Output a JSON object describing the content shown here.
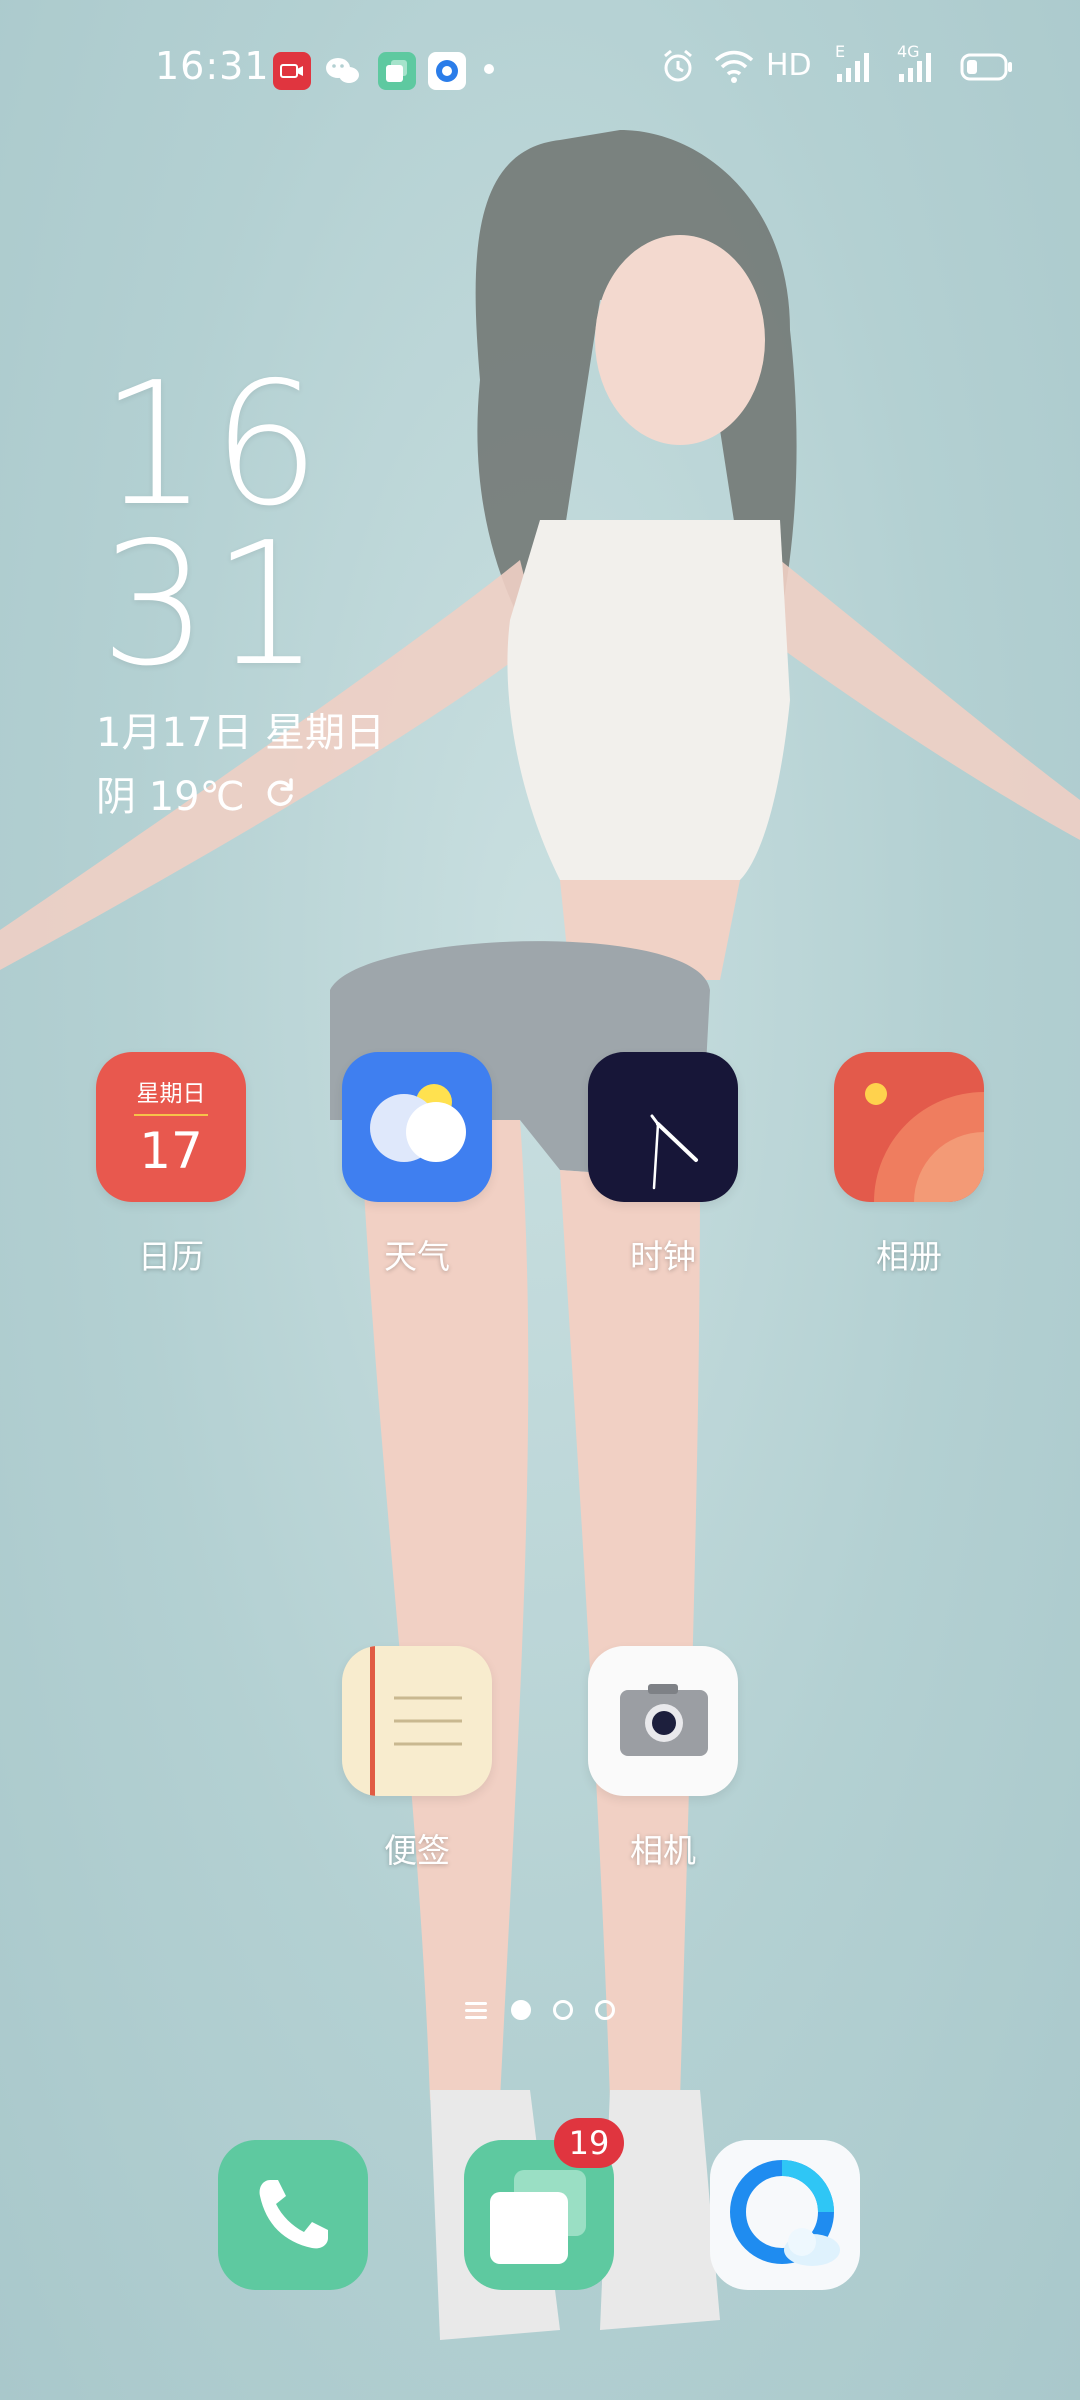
{
  "status_bar": {
    "time": "16:31",
    "right_indicators": [
      "alarm-icon",
      "wifi-icon",
      "HD",
      "E",
      "4G"
    ],
    "hd_label": "HD",
    "e_label": "E",
    "net_label": "4G"
  },
  "clock_widget": {
    "hour": "16",
    "minute": "31",
    "date": "1月17日 星期日",
    "weather": "阴 19℃"
  },
  "apps": {
    "calendar": {
      "label": "日历",
      "weekday": "星期日",
      "day": "17"
    },
    "weather": {
      "label": "天气"
    },
    "clock": {
      "label": "时钟"
    },
    "gallery": {
      "label": "相册"
    },
    "notes": {
      "label": "便签"
    },
    "camera": {
      "label": "相机"
    }
  },
  "dock": {
    "messages_badge": "19"
  },
  "colors": {
    "calendar": "#e8584e",
    "weather": "#3f7ff0",
    "clock": "#171638",
    "gallery": "#e35a4b",
    "dock_green": "#5ec9a0",
    "badge": "#e0353f"
  }
}
